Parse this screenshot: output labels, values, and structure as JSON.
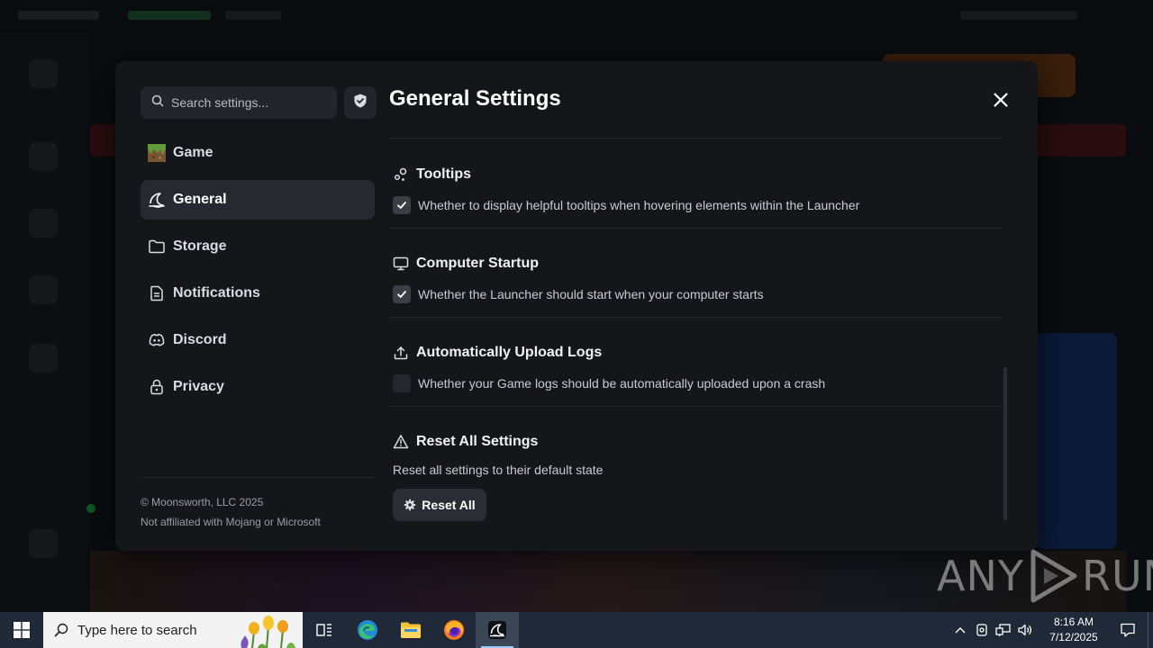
{
  "search": {
    "placeholder": "Search settings..."
  },
  "sidebar": {
    "items": [
      {
        "label": "Game",
        "icon": "grass-block-icon",
        "active": false
      },
      {
        "label": "General",
        "icon": "launcher-logo-icon",
        "active": true
      },
      {
        "label": "Storage",
        "icon": "folder-icon",
        "active": false
      },
      {
        "label": "Notifications",
        "icon": "document-icon",
        "active": false
      },
      {
        "label": "Discord",
        "icon": "discord-icon",
        "active": false
      },
      {
        "label": "Privacy",
        "icon": "lock-icon",
        "active": false
      }
    ],
    "footer": {
      "copyright": "© Moonsworth, LLC 2025",
      "disclaimer": "Not affiliated with Mojang or Microsoft"
    }
  },
  "main": {
    "title": "General Settings",
    "sections": [
      {
        "heading": "Tooltips",
        "icon": "tooltip-icon",
        "option": "Whether to display helpful tooltips when hovering elements within the Launcher",
        "checked": true
      },
      {
        "heading": "Computer Startup",
        "icon": "monitor-icon",
        "option": "Whether the Launcher should start when your computer starts",
        "checked": true
      },
      {
        "heading": "Automatically Upload Logs",
        "icon": "upload-icon",
        "option": "Whether your Game logs should be automatically uploaded upon a crash",
        "checked": false
      }
    ],
    "reset": {
      "heading": "Reset All Settings",
      "description": "Reset all settings to their default state",
      "button_label": "Reset All"
    }
  },
  "watermark": {
    "left": "ANY",
    "right": "RUN"
  },
  "taskbar": {
    "search_placeholder": "Type here to search",
    "time": "8:16 AM",
    "date": "7/12/2025"
  },
  "colors": {
    "modal_bg": "#14161a",
    "active_item": "#262930",
    "checkbox": "#3a3e45",
    "taskbar": "#1f2937"
  }
}
